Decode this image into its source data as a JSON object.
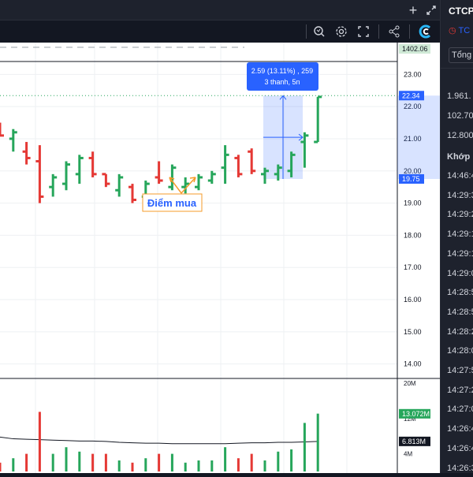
{
  "topbar": {
    "add_icon": "plus-icon",
    "expand_icon": "fullscreen-icon"
  },
  "toolbar": {
    "icons": [
      "quick-search-icon",
      "settings-icon",
      "fullscreen-icon",
      "share-icon",
      "brand-icon"
    ]
  },
  "chart": {
    "indicator_value": "1402.06",
    "price_ticks": [
      "23.00",
      "22.00",
      "21.00",
      "20.00",
      "19.00",
      "18.00",
      "17.00",
      "16.00",
      "15.00",
      "14.00"
    ],
    "last_price_tag": "22.34",
    "low_price_tag": "19.75",
    "measure_tooltip_line1": "2.59 (13.11%) , 259",
    "measure_tooltip_line2": "3 thanh, 5n",
    "buy_annotation": "Điểm mua",
    "volume_ticks": [
      "20M",
      "12M",
      "4M"
    ],
    "volume_tag_green": "13.072M",
    "volume_tag_black": "6.813M"
  },
  "chart_data": {
    "type": "ohlc",
    "price_ylim": [
      13.6,
      23.4
    ],
    "volume_ylim": [
      0,
      20
    ],
    "bars": [
      {
        "o": 21.3,
        "h": 21.5,
        "l": 21.1,
        "c": 21.1,
        "v": 2
      },
      {
        "o": 21.0,
        "h": 21.3,
        "l": 20.6,
        "c": 21.2,
        "v": 3
      },
      {
        "o": 20.6,
        "h": 20.9,
        "l": 20.2,
        "c": 20.4,
        "v": 4
      },
      {
        "o": 20.3,
        "h": 20.8,
        "l": 19.0,
        "c": 19.2,
        "v": 13.5
      },
      {
        "o": 19.5,
        "h": 19.9,
        "l": 19.2,
        "c": 19.8,
        "v": 4
      },
      {
        "o": 19.6,
        "h": 20.3,
        "l": 19.4,
        "c": 20.2,
        "v": 5.5
      },
      {
        "o": 19.9,
        "h": 20.5,
        "l": 19.6,
        "c": 20.4,
        "v": 4.5
      },
      {
        "o": 20.4,
        "h": 20.6,
        "l": 19.8,
        "c": 19.9,
        "v": 4
      },
      {
        "o": 19.9,
        "h": 19.9,
        "l": 19.5,
        "c": 19.6,
        "v": 4
      },
      {
        "o": 19.4,
        "h": 19.9,
        "l": 19.2,
        "c": 19.8,
        "v": 2.5
      },
      {
        "o": 19.5,
        "h": 19.6,
        "l": 19.0,
        "c": 19.1,
        "v": 2
      },
      {
        "o": 19.2,
        "h": 19.7,
        "l": 19.0,
        "c": 19.6,
        "v": 3
      },
      {
        "o": 19.8,
        "h": 20.3,
        "l": 19.6,
        "c": 19.7,
        "v": 4
      },
      {
        "o": 19.5,
        "h": 20.2,
        "l": 19.4,
        "c": 20.1,
        "v": 4
      },
      {
        "o": 19.5,
        "h": 19.8,
        "l": 19.3,
        "c": 19.6,
        "v": 2
      },
      {
        "o": 19.5,
        "h": 19.9,
        "l": 19.4,
        "c": 19.8,
        "v": 2.5
      },
      {
        "o": 19.7,
        "h": 20.0,
        "l": 19.6,
        "c": 19.9,
        "v": 2.5
      },
      {
        "o": 20.1,
        "h": 20.8,
        "l": 19.6,
        "c": 20.5,
        "v": 5.5
      },
      {
        "o": 20.4,
        "h": 20.5,
        "l": 19.8,
        "c": 19.9,
        "v": 3
      },
      {
        "o": 20.6,
        "h": 20.7,
        "l": 19.9,
        "c": 20.0,
        "v": 4
      },
      {
        "o": 19.9,
        "h": 20.1,
        "l": 19.6,
        "c": 20.0,
        "v": 2.5
      },
      {
        "o": 19.9,
        "h": 20.2,
        "l": 19.7,
        "c": 20.1,
        "v": 4.5
      },
      {
        "o": 20.0,
        "h": 20.6,
        "l": 19.8,
        "c": 20.5,
        "v": 5
      },
      {
        "o": 20.9,
        "h": 21.2,
        "l": 20.1,
        "c": 21.1,
        "v": 11
      },
      {
        "o": 20.9,
        "h": 22.3,
        "l": 20.9,
        "c": 22.3,
        "v": 13.1
      }
    ],
    "volume_ma": [
      7.8,
      7.4,
      7.3,
      7.2,
      7.1,
      7.0,
      6.9,
      6.9,
      6.8,
      6.6,
      6.5,
      6.4,
      6.4,
      6.3,
      6.3,
      6.3,
      6.3,
      6.3,
      6.4,
      6.5,
      6.5,
      6.6,
      6.6,
      6.7,
      6.8
    ]
  },
  "right_panel": {
    "title": "CTCP",
    "subtitle": "TC",
    "total_button": "Tổng",
    "stats": [
      "1.961.",
      "102.70",
      "12.800"
    ],
    "match_header": "Khớp",
    "times": [
      "14:46:4",
      "14:29:3",
      "14:29:2",
      "14:29:1",
      "14:29:1",
      "14:29:0",
      "14:28:5",
      "14:28:5",
      "14:28:2",
      "14:28:0",
      "14:27:5",
      "14:27:2",
      "14:27:0",
      "14:26:4",
      "14:26:4",
      "14:26:3"
    ]
  },
  "colors": {
    "up": "#26a65b",
    "down": "#e53935",
    "accent": "#2962ff",
    "annotation": "#f59b2a"
  }
}
